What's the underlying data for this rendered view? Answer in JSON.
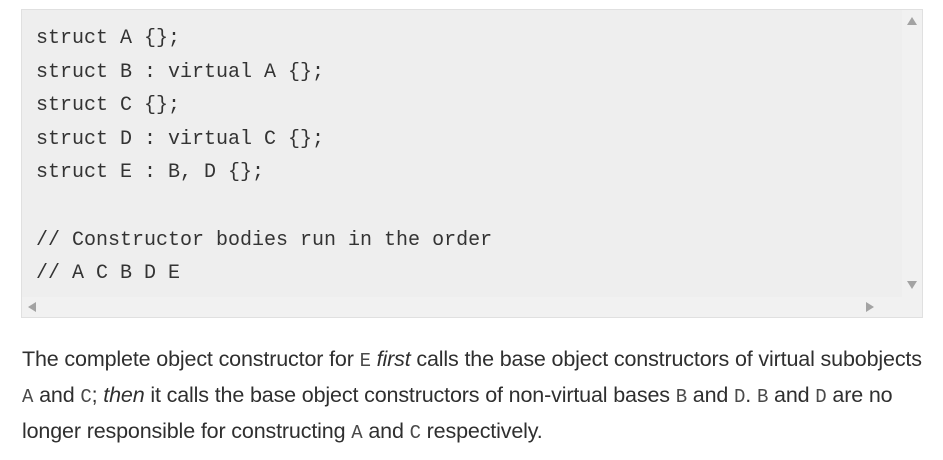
{
  "code_block": {
    "lines": [
      "struct A {};",
      "struct B : virtual A {};",
      "struct C {};",
      "struct D : virtual C {};",
      "struct E : B, D {};",
      "",
      "// Constructor bodies run in the order",
      "// A C B D E"
    ]
  },
  "paragraph": {
    "t1": "The complete object constructor for ",
    "c1": "E",
    "t2": " ",
    "em1": "first",
    "t3": " calls the base object constructors of virtual subobjects ",
    "c2": "A",
    "t4": " and ",
    "c3": "C",
    "t5": "; ",
    "em2": "then",
    "t6": " it calls the base object constructors of non-virtual bases ",
    "c4": "B",
    "t7": " and ",
    "c5": "D",
    "t8": ". ",
    "c6": "B",
    "t9": " and ",
    "c7": "D",
    "t10": " are no longer responsible for constructing ",
    "c8": "A",
    "t11": " and ",
    "c9": "C",
    "t12": " respectively."
  }
}
